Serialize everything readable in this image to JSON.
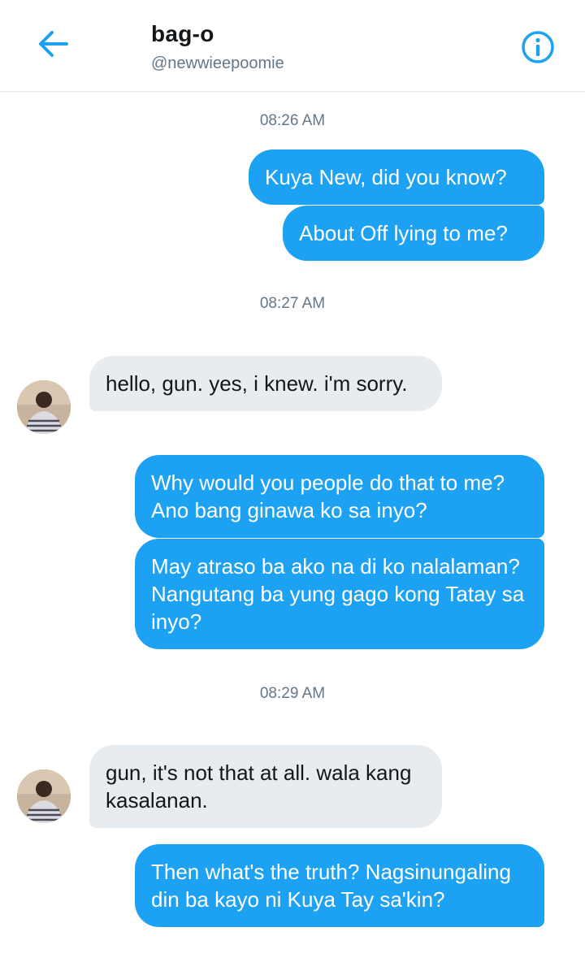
{
  "header": {
    "title": "bag-o",
    "handle": "@newwieepoomie",
    "back_icon": "arrow-left-icon",
    "info_icon": "info-circle-icon"
  },
  "colors": {
    "accent": "#1da1f2",
    "incoming_bubble": "#e6ecf0",
    "text_primary": "#14171a",
    "text_secondary": "#657786"
  },
  "conversation": {
    "timestamps": [
      "08:26 AM",
      "08:27 AM",
      "08:29 AM"
    ],
    "messages": [
      {
        "sender": "me",
        "text": "Kuya New, did you know?"
      },
      {
        "sender": "me",
        "text": "About Off lying to me?"
      },
      {
        "sender": "them",
        "text": "hello, gun. yes, i knew. i'm sorry."
      },
      {
        "sender": "me",
        "text": "Why would you people do that to me? Ano bang ginawa ko sa inyo?"
      },
      {
        "sender": "me",
        "text": "May atraso ba ako na di ko nalalaman? Nangutang ba yung gago kong Tatay sa inyo?"
      },
      {
        "sender": "them",
        "text": "gun, it's not that at all. wala kang kasalanan."
      },
      {
        "sender": "me",
        "text": "Then what's the truth? Nagsinungaling din ba kayo ni Kuya Tay sa'kin?"
      }
    ]
  }
}
